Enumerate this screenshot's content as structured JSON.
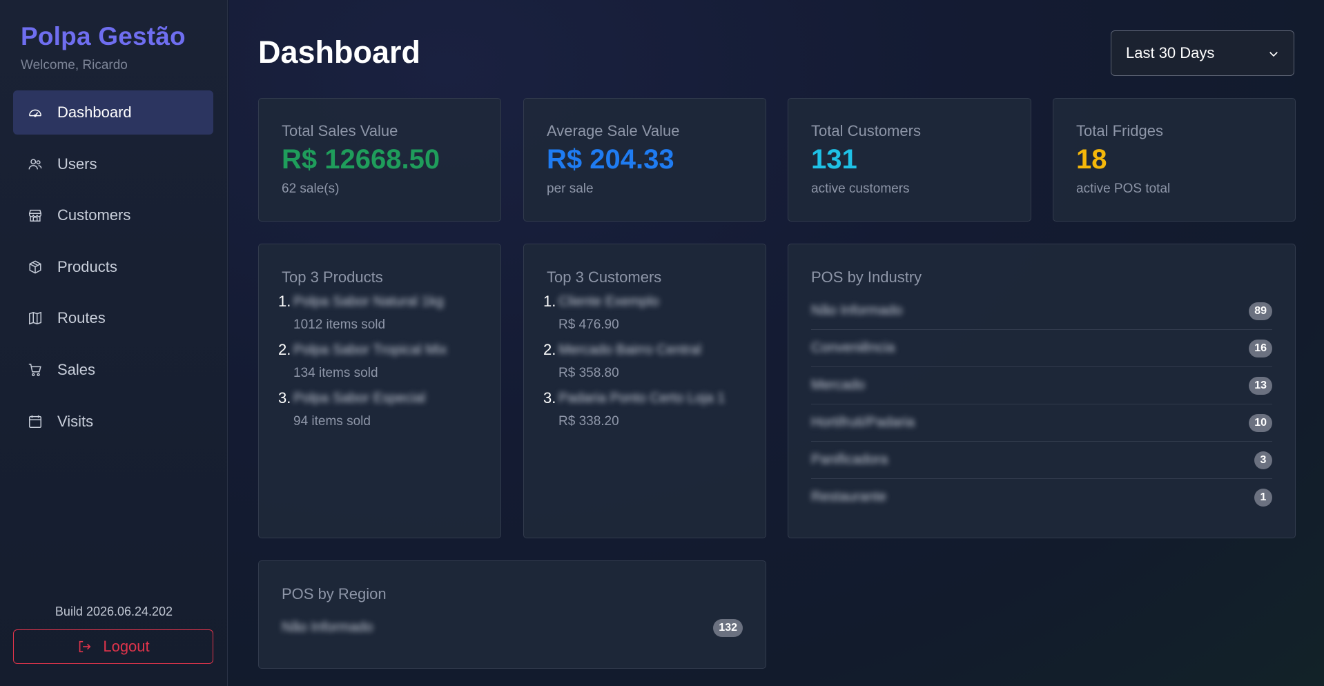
{
  "brand": "Polpa Gestão",
  "welcome": "Welcome, Ricardo",
  "nav": [
    {
      "label": "Dashboard",
      "icon": "speedometer-icon"
    },
    {
      "label": "Users",
      "icon": "users-icon"
    },
    {
      "label": "Customers",
      "icon": "store-icon"
    },
    {
      "label": "Products",
      "icon": "box-icon"
    },
    {
      "label": "Routes",
      "icon": "map-icon"
    },
    {
      "label": "Sales",
      "icon": "cart-icon"
    },
    {
      "label": "Visits",
      "icon": "calendar-icon"
    }
  ],
  "active_nav": "Dashboard",
  "build": "Build 2026.06.24.202",
  "logout_label": "Logout",
  "page_title": "Dashboard",
  "date_range": "Last 30 Days",
  "stats": [
    {
      "title": "Total Sales Value",
      "value": "R$ 12668.50",
      "sub": "62 sale(s)",
      "color": "#1f9d5b"
    },
    {
      "title": "Average Sale Value",
      "value": "R$ 204.33",
      "sub": "per sale",
      "color": "#1f7cf2"
    },
    {
      "title": "Total Customers",
      "value": "131",
      "sub": "active customers",
      "color": "#1fc1e6"
    },
    {
      "title": "Total Fridges",
      "value": "18",
      "sub": "active POS total",
      "color": "#f5b80a"
    }
  ],
  "top_products": {
    "title": "Top 3 Products",
    "items": [
      {
        "rank": "1.",
        "name": "Polpa Sabor Natural 1kg",
        "sub": "1012 items sold"
      },
      {
        "rank": "2.",
        "name": "Polpa Sabor Tropical Mix",
        "sub": "134 items sold"
      },
      {
        "rank": "3.",
        "name": "Polpa Sabor Especial",
        "sub": "94 items sold"
      }
    ]
  },
  "top_customers": {
    "title": "Top 3 Customers",
    "items": [
      {
        "rank": "1.",
        "name": "Cliente Exemplo",
        "sub": "R$ 476.90"
      },
      {
        "rank": "2.",
        "name": "Mercado Bairro Central",
        "sub": "R$ 358.80"
      },
      {
        "rank": "3.",
        "name": "Padaria Ponto Certo Loja 1",
        "sub": "R$ 338.20"
      }
    ]
  },
  "pos_industry": {
    "title": "POS by Industry",
    "items": [
      {
        "name": "Não Informado",
        "count": "89"
      },
      {
        "name": "Conveniência",
        "count": "16"
      },
      {
        "name": "Mercado",
        "count": "13"
      },
      {
        "name": "Hortifruti/Padaria",
        "count": "10"
      },
      {
        "name": "Panificadora",
        "count": "3"
      },
      {
        "name": "Restaurante",
        "count": "1"
      }
    ]
  },
  "pos_region": {
    "title": "POS by Region",
    "items": [
      {
        "name": "Não Informado",
        "count": "132"
      }
    ]
  }
}
